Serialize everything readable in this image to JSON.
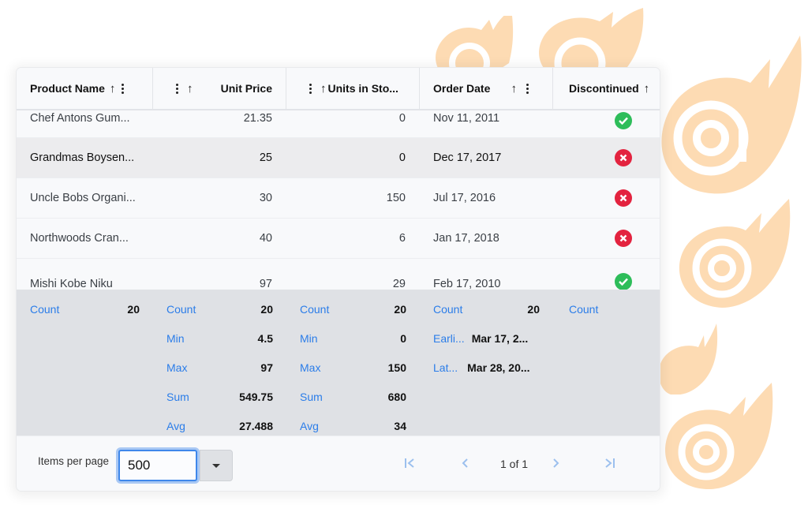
{
  "theme": {
    "accent": "#2b7de9",
    "ok": "#2ebd5a",
    "error": "#e3233f",
    "logo": "#fddbb3"
  },
  "grid": {
    "columns": [
      {
        "label": "Product Name",
        "sort": "ascending",
        "menu": true
      },
      {
        "label": "Unit Price",
        "sort": "ascending",
        "menu": true
      },
      {
        "label": "Units in Sto...",
        "sort": "ascending",
        "menu": true
      },
      {
        "label": "Order Date",
        "sort": "ascending",
        "menu": true
      },
      {
        "label": "Discontinued",
        "sort": "ascending",
        "menu": false
      }
    ],
    "rows": [
      {
        "product": "Chef Antons Gum...",
        "price": "21.35",
        "units": "0",
        "date": "Nov 11, 2011",
        "discontinued": true
      },
      {
        "product": "Grandmas Boysen...",
        "price": "25",
        "units": "0",
        "date": "Dec 17, 2017",
        "discontinued": false
      },
      {
        "product": "Uncle Bobs Organi...",
        "price": "30",
        "units": "150",
        "date": "Jul 17, 2016",
        "discontinued": false
      },
      {
        "product": "Northwoods Cran...",
        "price": "40",
        "units": "6",
        "date": "Jan 17, 2018",
        "discontinued": false
      },
      {
        "product": "Mishi Kobe Niku",
        "price": "97",
        "units": "29",
        "date": "Feb 17, 2010",
        "discontinued": true
      }
    ],
    "summaries": {
      "product": [
        {
          "label": "Count",
          "value": "20"
        }
      ],
      "price": [
        {
          "label": "Count",
          "value": "20"
        },
        {
          "label": "Min",
          "value": "4.5"
        },
        {
          "label": "Max",
          "value": "97"
        },
        {
          "label": "Sum",
          "value": "549.75"
        },
        {
          "label": "Avg",
          "value": "27.488"
        }
      ],
      "units": [
        {
          "label": "Count",
          "value": "20"
        },
        {
          "label": "Min",
          "value": "0"
        },
        {
          "label": "Max",
          "value": "150"
        },
        {
          "label": "Sum",
          "value": "680"
        },
        {
          "label": "Avg",
          "value": "34"
        }
      ],
      "date": [
        {
          "label": "Count",
          "value": "20"
        },
        {
          "label": "Earli...",
          "value": "Mar 17, 2..."
        },
        {
          "label": "Lat...",
          "value": "Mar 28, 20..."
        }
      ],
      "discontinued": [
        {
          "label": "Count",
          "value": ""
        }
      ]
    }
  },
  "paginator": {
    "items_per_page_label": "Items per page",
    "items_per_page_value": "500",
    "page_info": "1 of 1",
    "icons": {
      "first": "first-page-icon",
      "prev": "prev-page-icon",
      "next": "next-page-icon",
      "last": "last-page-icon"
    }
  }
}
